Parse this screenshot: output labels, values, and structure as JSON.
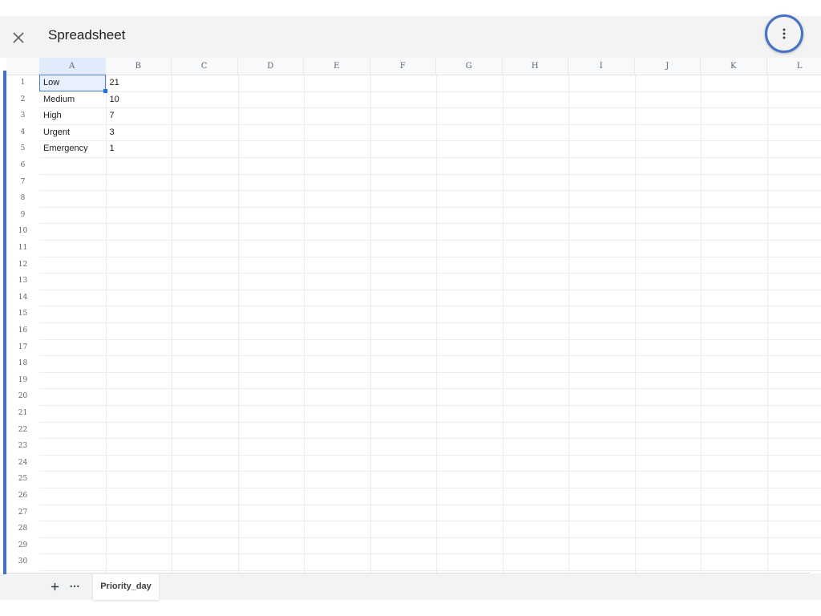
{
  "window": {
    "title": "Spreadsheet",
    "close_icon": "close-icon",
    "more_icon": "more-vertical-icon"
  },
  "columns": [
    "A",
    "B",
    "C",
    "D",
    "E",
    "F",
    "G",
    "H",
    "I",
    "J",
    "K",
    "L"
  ],
  "rows": [
    "1",
    "2",
    "3",
    "4",
    "5",
    "6",
    "7",
    "8",
    "9",
    "10",
    "11",
    "12",
    "13",
    "14",
    "15",
    "16",
    "17",
    "18",
    "19",
    "20",
    "21",
    "22",
    "23",
    "24",
    "25",
    "26",
    "27",
    "28",
    "29",
    "30"
  ],
  "cells": [
    {
      "row": 1,
      "col": "A",
      "value": "Low"
    },
    {
      "row": 1,
      "col": "B",
      "value": "21"
    },
    {
      "row": 2,
      "col": "A",
      "value": "Medium"
    },
    {
      "row": 2,
      "col": "B",
      "value": "10"
    },
    {
      "row": 3,
      "col": "A",
      "value": "High"
    },
    {
      "row": 3,
      "col": "B",
      "value": "7"
    },
    {
      "row": 4,
      "col": "A",
      "value": "Urgent"
    },
    {
      "row": 4,
      "col": "B",
      "value": "3"
    },
    {
      "row": 5,
      "col": "A",
      "value": "Emergency"
    },
    {
      "row": 5,
      "col": "B",
      "value": "1"
    }
  ],
  "selected_cell": "A1",
  "sheets": {
    "add_icon": "plus-icon",
    "menu_icon": "more-horizontal-icon",
    "active_tab": "Priority_day"
  },
  "colors": {
    "accent": "#4472c4",
    "selection_border": "#4a7fd4",
    "selection_fill": "#e8f0fe"
  }
}
